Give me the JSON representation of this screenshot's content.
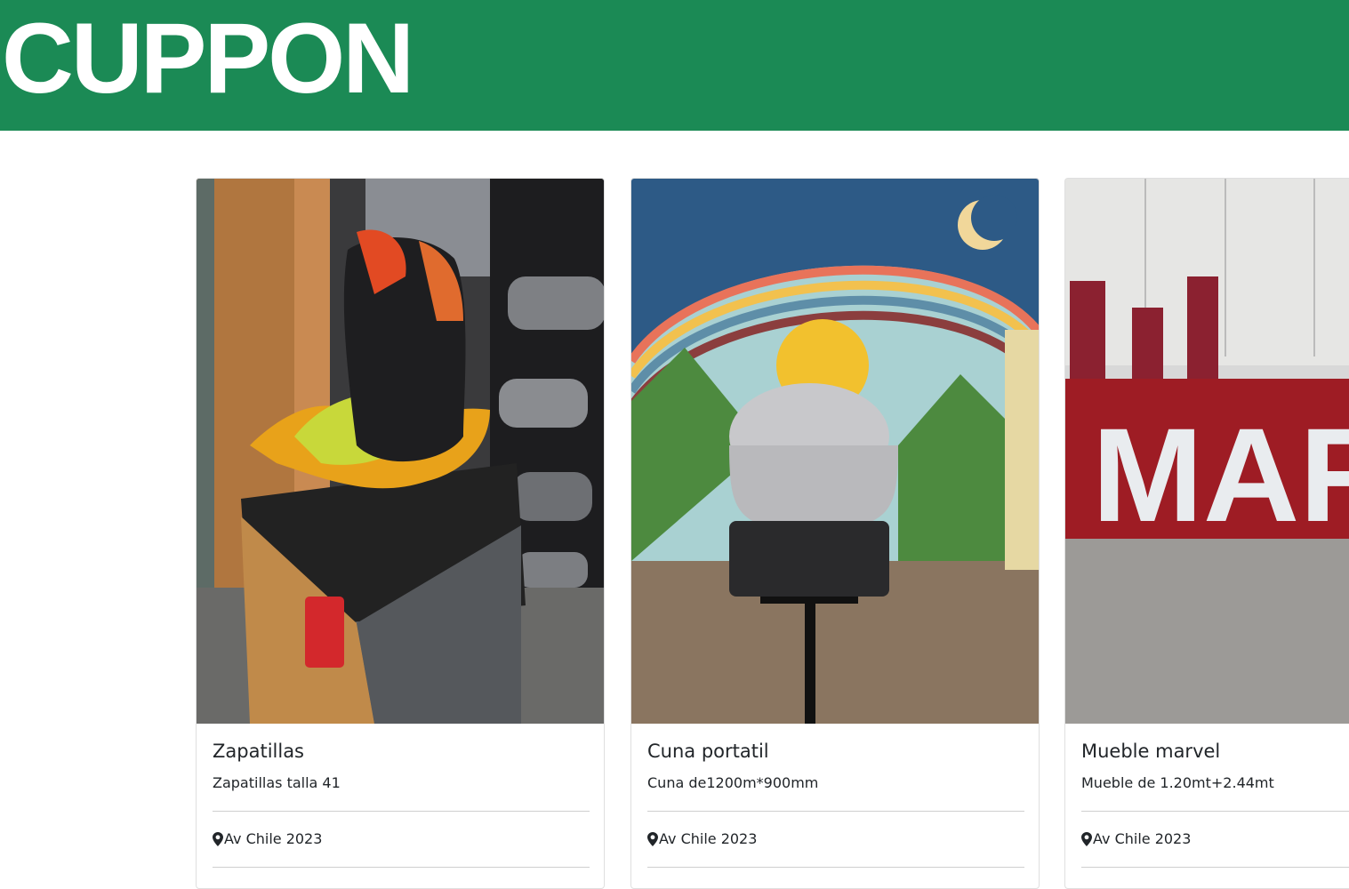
{
  "header": {
    "brand": "CUPPON",
    "background_color": "#1b8a55"
  },
  "listings": [
    {
      "title": "Zapatillas",
      "description": "Zapatillas talla 41",
      "location": "Av Chile 2023",
      "image_icon": "sneaker-photo"
    },
    {
      "title": "Cuna portatil",
      "description": "Cuna de1200m*900mm",
      "location": "Av Chile 2023",
      "image_icon": "bassinet-photo"
    },
    {
      "title": "Mueble marvel",
      "description": "Mueble de 1.20mt+2.44mt",
      "location": "Av Chile 2023",
      "image_icon": "marvel-sign-photo"
    }
  ],
  "marvel_sign_text": "MARVEL",
  "icons": {
    "location": "map-pin-icon"
  }
}
